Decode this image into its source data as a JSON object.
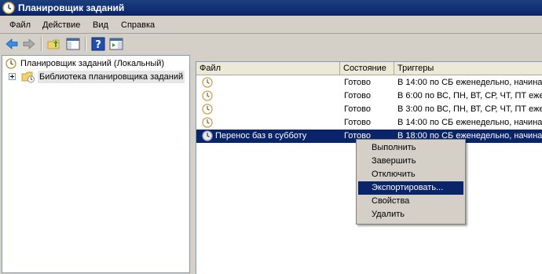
{
  "window": {
    "title": "Планировщик заданий"
  },
  "menu": [
    "Файл",
    "Действие",
    "Вид",
    "Справка"
  ],
  "toolbar": [
    "back-icon",
    "forward-icon",
    "up-folder-icon",
    "show-hide-tree-icon",
    "help-icon",
    "action-pane-icon"
  ],
  "tree": {
    "root": "Планировщик заданий (Локальный)",
    "child": "Библиотека планировщика заданий"
  },
  "table": {
    "columns": [
      "Файл",
      "Состояние",
      "Триггеры"
    ],
    "rows": [
      {
        "name": "",
        "status": "Готово",
        "trigger": "В 14:00 по СБ еженедельно, начиная"
      },
      {
        "name": "",
        "status": "Готово",
        "trigger": "В 6:00 по ВС, ПН, ВТ, СР, ЧТ, ПТ еже"
      },
      {
        "name": "",
        "status": "Готово",
        "trigger": "В 3:00 по ВС, ПН, ВТ, СР, ЧТ, ПТ еже"
      },
      {
        "name": "",
        "status": "Готово",
        "trigger": "В 14:00 по СБ еженедельно, начиная"
      },
      {
        "name": "Перенос баз в субботу",
        "status": "Готово",
        "trigger": "В 18:00 по СБ еженедельно, начиная"
      }
    ],
    "selected_row": 4
  },
  "context_menu": [
    "Выполнить",
    "Завершить",
    "Отключить",
    "Экспортировать...",
    "Свойства",
    "Удалить"
  ],
  "colors": {
    "selection": "#0a246a",
    "titlebar": "#0a246a"
  }
}
